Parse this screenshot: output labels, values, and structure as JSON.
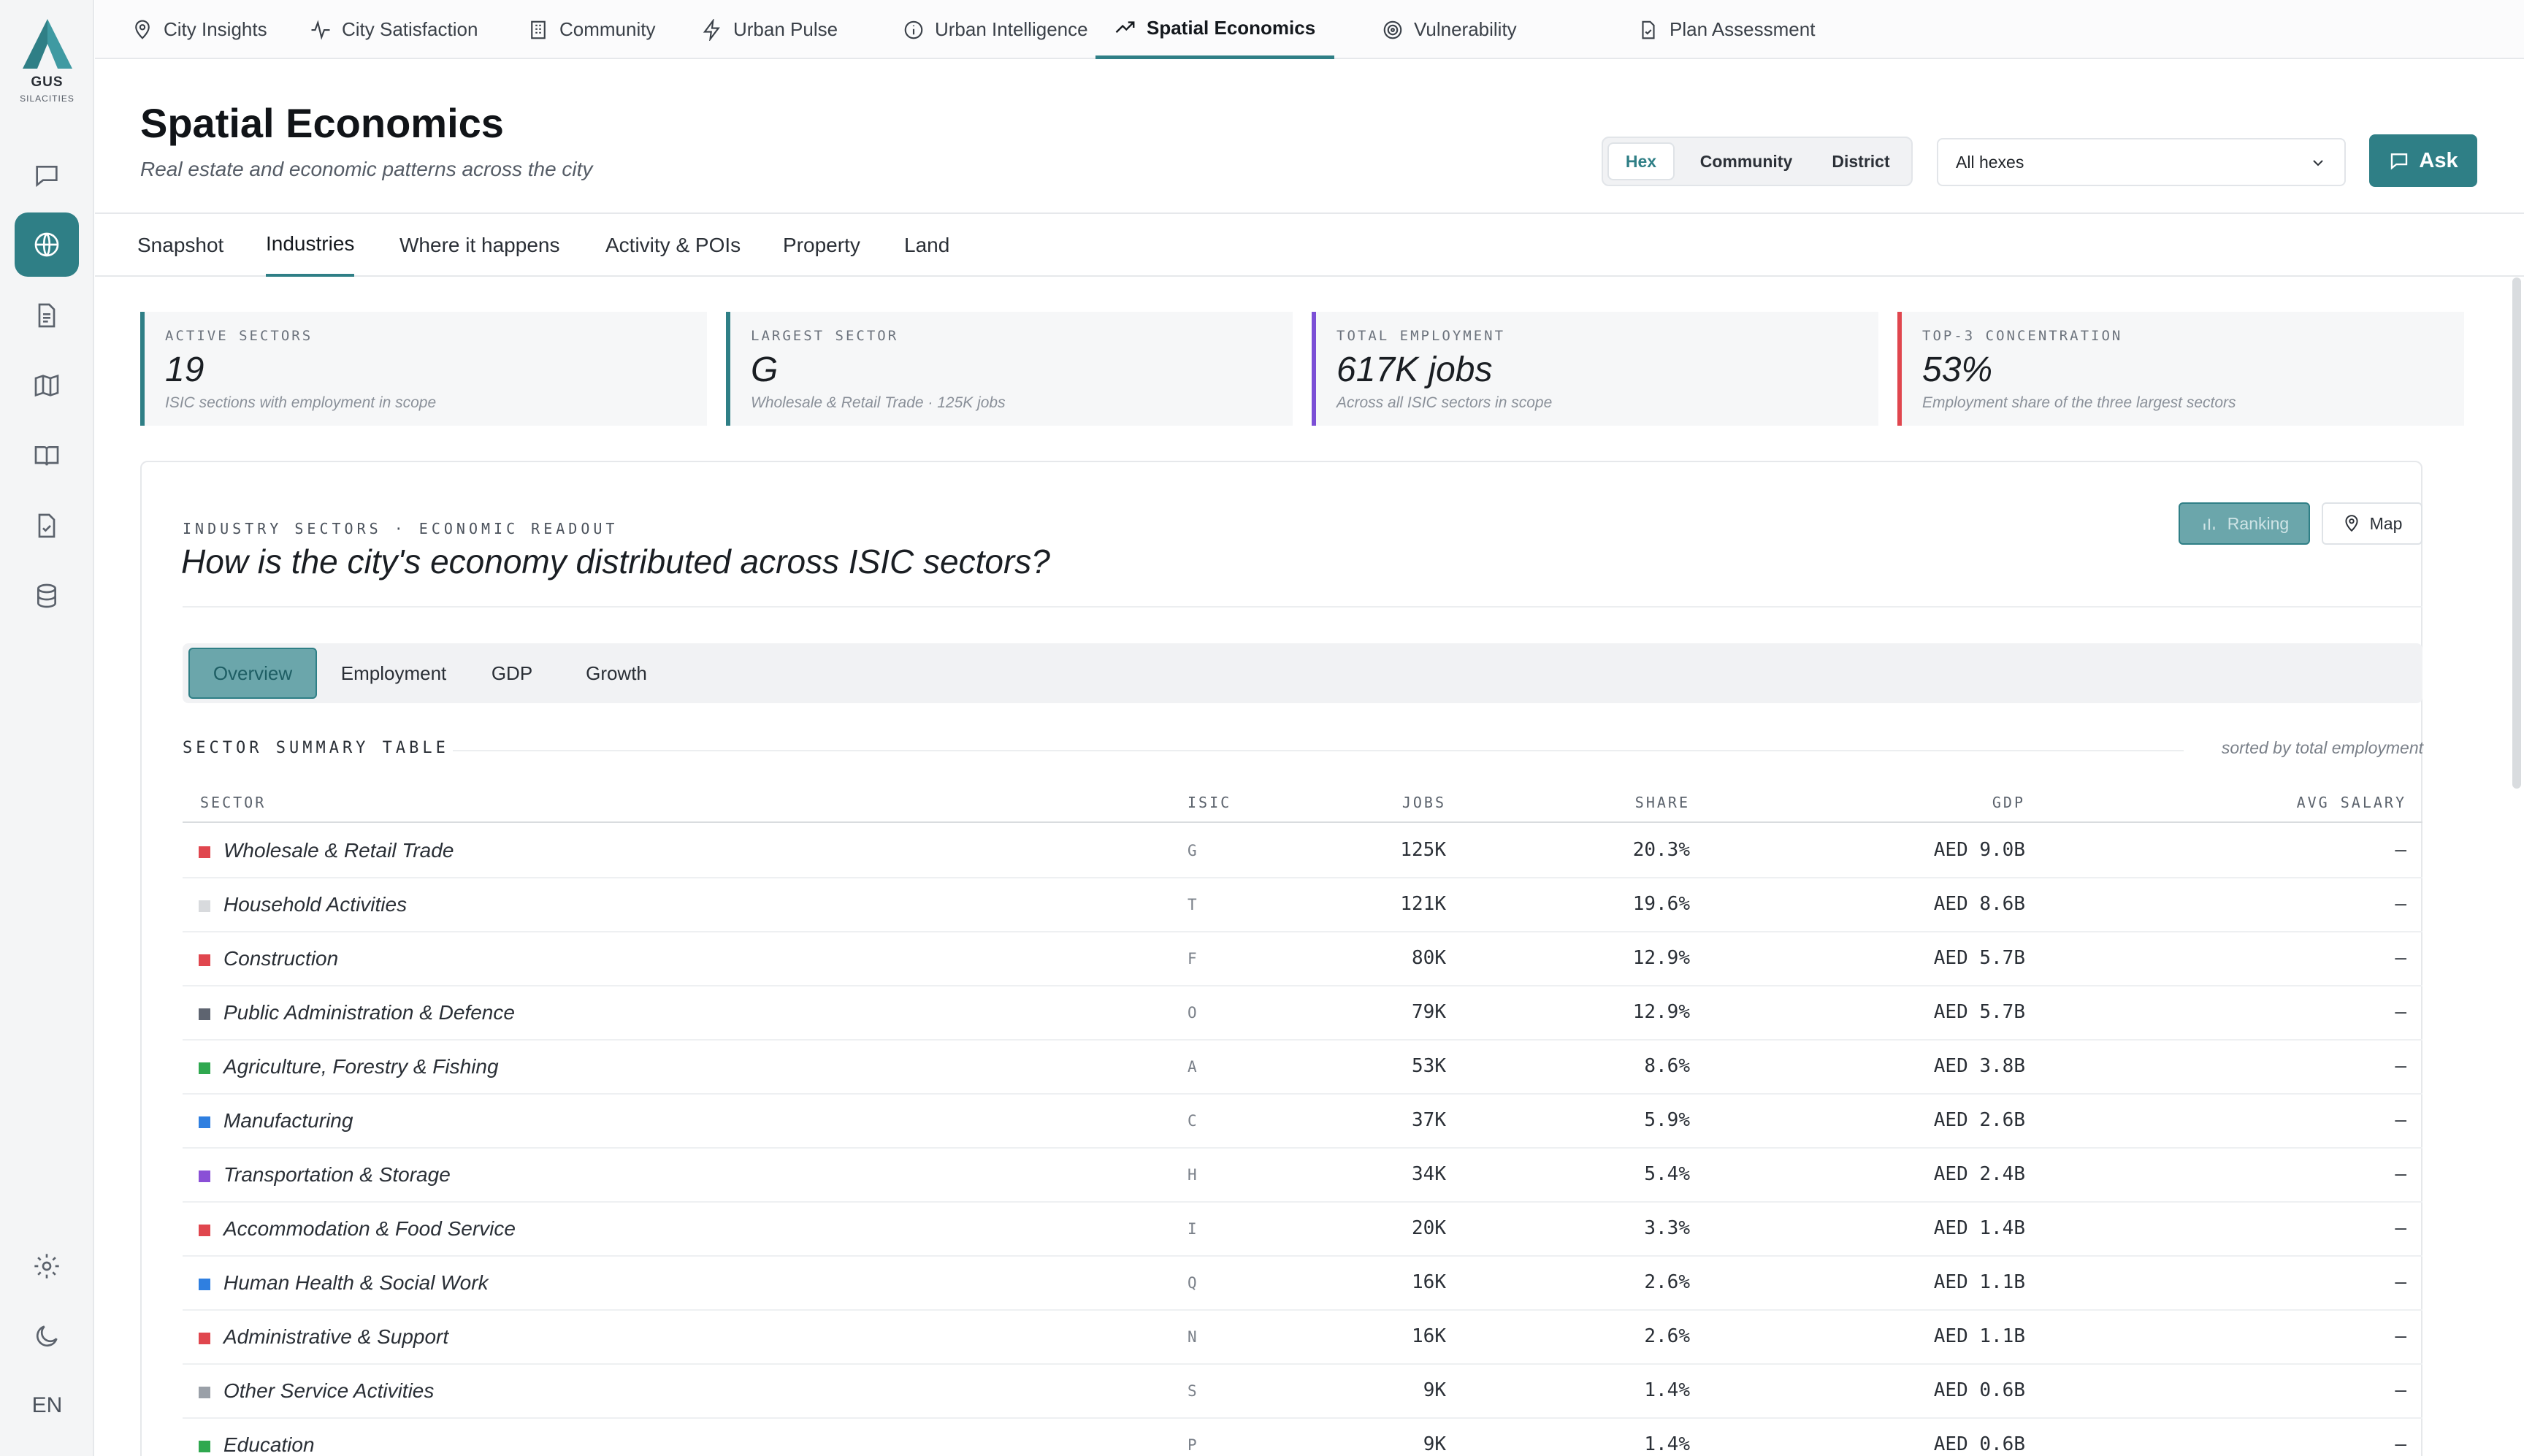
{
  "sidebar": {
    "brand": "GUS",
    "brand_sub": "SILACITIES",
    "language": "EN"
  },
  "topnav": {
    "items": [
      {
        "label": "City Insights",
        "icon": "map-pin-icon"
      },
      {
        "label": "City Satisfaction",
        "icon": "pulse-icon"
      },
      {
        "label": "Community",
        "icon": "building-icon"
      },
      {
        "label": "Urban Pulse",
        "icon": "bolt-icon"
      },
      {
        "label": "Urban Intelligence",
        "icon": "info-icon"
      },
      {
        "label": "Spatial Economics",
        "icon": "trend-up-icon"
      },
      {
        "label": "Vulnerability",
        "icon": "target-icon"
      },
      {
        "label": "Plan Assessment",
        "icon": "doc-check-icon"
      }
    ],
    "active": "Spatial Economics"
  },
  "header": {
    "title": "Spatial Economics",
    "subtitle": "Real estate and economic patterns across the city",
    "scale_options": [
      "Hex",
      "Community",
      "District"
    ],
    "scale_active": "Hex",
    "area_select": "All hexes",
    "ask_label": "Ask"
  },
  "subtabs": {
    "items": [
      "Snapshot",
      "Industries",
      "Where it happens",
      "Activity & POIs",
      "Property",
      "Land"
    ],
    "active": "Industries"
  },
  "kpis": [
    {
      "label": "ACTIVE SECTORS",
      "value": "19",
      "note": "ISIC sections with employment in scope",
      "color": "#2f7f86"
    },
    {
      "label": "LARGEST SECTOR",
      "value": "G",
      "note": "Wholesale & Retail Trade · 125K jobs",
      "color": "#2f7f86"
    },
    {
      "label": "TOTAL EMPLOYMENT",
      "value": "617K jobs",
      "note": "Across all ISIC sectors in scope",
      "color": "#7b4fd6"
    },
    {
      "label": "TOP-3 CONCENTRATION",
      "value": "53%",
      "note": "Employment share of the three largest sectors",
      "color": "#e0464e"
    }
  ],
  "panel": {
    "eyebrow": "INDUSTRY SECTORS · ECONOMIC READOUT",
    "question": "How is the city's economy distributed across ISIC sectors?",
    "ranking_label": "Ranking",
    "map_label": "Map",
    "view_tabs": [
      "Overview",
      "Employment",
      "GDP",
      "Growth"
    ],
    "view_active": "Overview",
    "table_title": "SECTOR SUMMARY TABLE",
    "sort_note": "sorted by total employment",
    "columns": [
      "SECTOR",
      "ISIC",
      "JOBS",
      "SHARE",
      "GDP",
      "AVG SALARY"
    ],
    "rows": [
      {
        "sector": "Wholesale & Retail Trade",
        "isic": "G",
        "jobs": "125K",
        "share": "20.3%",
        "gdp": "AED 9.0B",
        "salary": "—",
        "color": "#e0464e"
      },
      {
        "sector": "Household Activities",
        "isic": "T",
        "jobs": "121K",
        "share": "19.6%",
        "gdp": "AED 8.6B",
        "salary": "—",
        "color": "#d8dadd"
      },
      {
        "sector": "Construction",
        "isic": "F",
        "jobs": "80K",
        "share": "12.9%",
        "gdp": "AED 5.7B",
        "salary": "—",
        "color": "#e0464e"
      },
      {
        "sector": "Public Administration & Defence",
        "isic": "O",
        "jobs": "79K",
        "share": "12.9%",
        "gdp": "AED 5.7B",
        "salary": "—",
        "color": "#5e6470"
      },
      {
        "sector": "Agriculture, Forestry & Fishing",
        "isic": "A",
        "jobs": "53K",
        "share": "8.6%",
        "gdp": "AED 3.8B",
        "salary": "—",
        "color": "#2fa84f"
      },
      {
        "sector": "Manufacturing",
        "isic": "C",
        "jobs": "37K",
        "share": "5.9%",
        "gdp": "AED 2.6B",
        "salary": "—",
        "color": "#2f7fe0"
      },
      {
        "sector": "Transportation & Storage",
        "isic": "H",
        "jobs": "34K",
        "share": "5.4%",
        "gdp": "AED 2.4B",
        "salary": "—",
        "color": "#8a4fd6"
      },
      {
        "sector": "Accommodation & Food Service",
        "isic": "I",
        "jobs": "20K",
        "share": "3.3%",
        "gdp": "AED 1.4B",
        "salary": "—",
        "color": "#e0464e"
      },
      {
        "sector": "Human Health & Social Work",
        "isic": "Q",
        "jobs": "16K",
        "share": "2.6%",
        "gdp": "AED 1.1B",
        "salary": "—",
        "color": "#2f7fe0"
      },
      {
        "sector": "Administrative & Support",
        "isic": "N",
        "jobs": "16K",
        "share": "2.6%",
        "gdp": "AED 1.1B",
        "salary": "—",
        "color": "#e0464e"
      },
      {
        "sector": "Other Service Activities",
        "isic": "S",
        "jobs": "9K",
        "share": "1.4%",
        "gdp": "AED 0.6B",
        "salary": "—",
        "color": "#9aa0a8"
      },
      {
        "sector": "Education",
        "isic": "P",
        "jobs": "9K",
        "share": "1.4%",
        "gdp": "AED 0.6B",
        "salary": "—",
        "color": "#2fa84f"
      }
    ]
  }
}
